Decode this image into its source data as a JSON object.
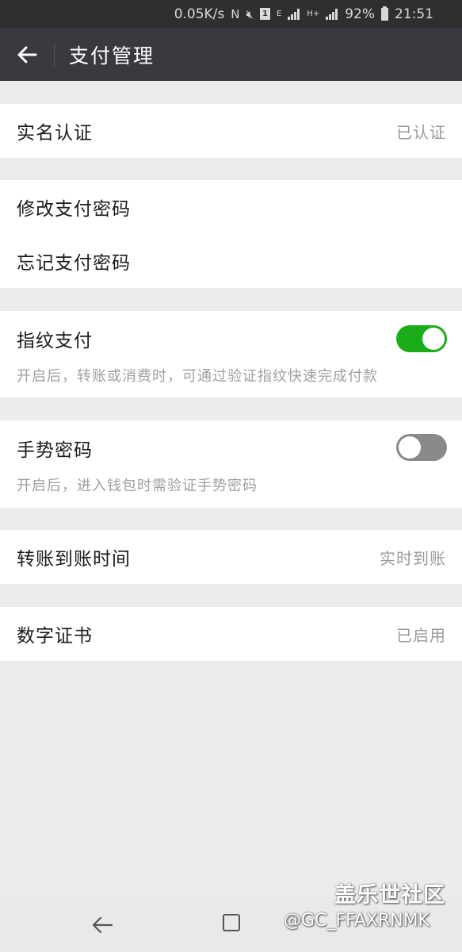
{
  "status_bar": {
    "speed": "0.05K/s",
    "nfc": "N",
    "sim": "1",
    "net_e": "E",
    "net_h": "H+",
    "battery": "92%",
    "time": "21:51"
  },
  "header": {
    "title": "支付管理",
    "back_icon": "arrow-left-icon"
  },
  "items": {
    "real_name": {
      "label": "实名认证",
      "value": "已认证"
    },
    "change_password": {
      "label": "修改支付密码"
    },
    "forgot_password": {
      "label": "忘记支付密码"
    },
    "fingerprint": {
      "label": "指纹支付",
      "desc": "开启后，转账或消费时，可通过验证指纹快速完成付款",
      "enabled": true
    },
    "gesture": {
      "label": "手势密码",
      "desc": "开启后，进入钱包时需验证手势密码",
      "enabled": false
    },
    "transfer_time": {
      "label": "转账到账时间",
      "value": "实时到账"
    },
    "certificate": {
      "label": "数字证书",
      "value": "已启用"
    }
  },
  "watermark": {
    "site": "盖乐世社区",
    "user": "@GC_FFAXRNMK"
  },
  "colors": {
    "title_bar": "#393a3f",
    "toggle_on": "#1aad19",
    "toggle_off": "#8a8a8a",
    "background": "#ebebeb"
  }
}
